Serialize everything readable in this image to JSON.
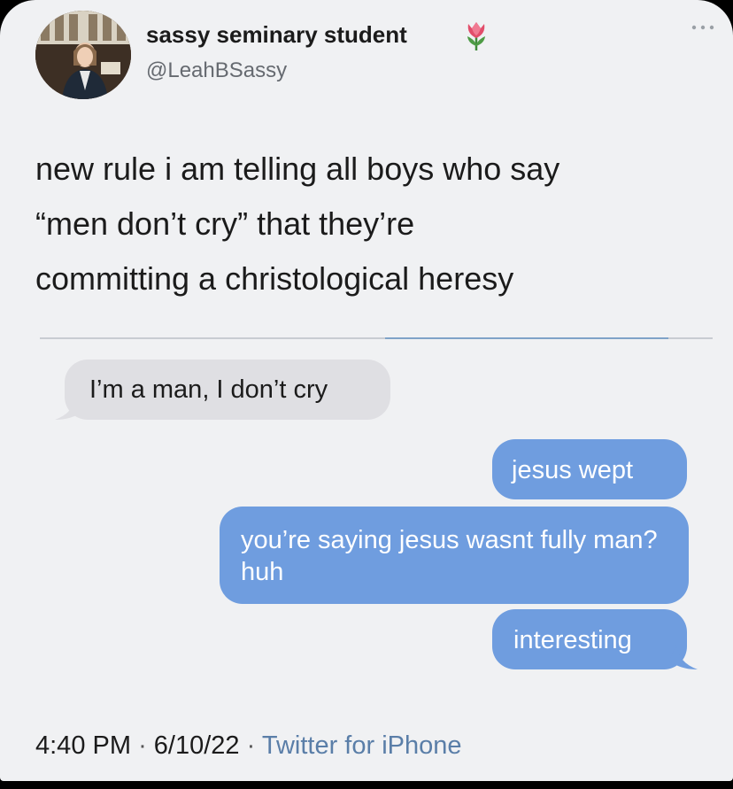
{
  "profile": {
    "display_name": "sassy seminary student",
    "handle": "@LeahBSassy",
    "avatar_icon": "profile-photo",
    "name_emoji": "tulip-icon"
  },
  "tweet": {
    "lines": [
      "new rule i am telling all boys who say",
      "“men don’t cry” that they’re",
      "committing a christological heresy"
    ]
  },
  "conversation": {
    "received": [
      {
        "text": "I’m a man, I don’t cry"
      }
    ],
    "sent": [
      {
        "text": "jesus wept"
      },
      {
        "text": "you’re saying jesus wasnt fully man? huh"
      },
      {
        "text": "interesting"
      }
    ]
  },
  "meta": {
    "time": "4:40 PM",
    "date": "6/10/22",
    "separator": "·",
    "source": "Twitter for iPhone"
  },
  "colors": {
    "received_bubble": "#dfdfe3",
    "sent_bubble": "#6f9ddf",
    "source_link": "#5a7ea8",
    "background": "#f0f1f3"
  }
}
